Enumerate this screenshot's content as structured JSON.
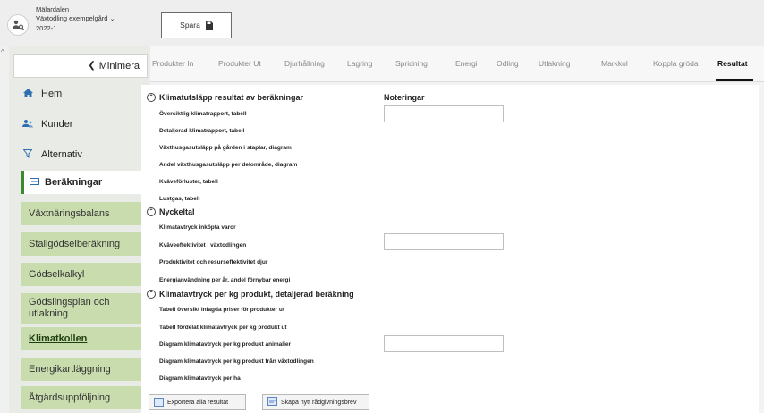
{
  "org": {
    "name": "Mälardalen",
    "farm": "Växtodling exempelgård",
    "year": "2022-1",
    "chevron": "⌄"
  },
  "toolbar": {
    "save_label": "Spara"
  },
  "sidebar": {
    "minimize_label": "Minimera",
    "items": [
      {
        "label": "Hem",
        "icon": "home-icon"
      },
      {
        "label": "Kunder",
        "icon": "users-icon"
      },
      {
        "label": "Alternativ",
        "icon": "filter-icon"
      },
      {
        "label": "Beräkningar",
        "icon": "calculator-icon"
      }
    ],
    "sub_items": [
      "Växtnäringsbalans",
      "Stallgödselberäkning",
      "Gödselkalkyl",
      "Gödslingsplan och utlakning",
      "Klimatkollen",
      "Energikartläggning",
      "Åtgärdsuppföljning"
    ]
  },
  "tabs": [
    "Produkter In",
    "Produkter Ut",
    "Djurhållning",
    "Lagring",
    "Spridning",
    "Energi",
    "Odling",
    "Utlakning",
    "Markkol",
    "Koppla gröda",
    "Resultat"
  ],
  "active_tab": "Resultat",
  "sections": [
    {
      "title": "Klimatutsläpp resultat av beräkningar",
      "items": [
        "Översiktlig klimatrapport, tabell",
        "Detaljerad klimatrapport, tabell",
        "Växthusgasutsläpp på gården i staplar, diagram",
        "Andel växthusgasutsläpp per delområde, diagram",
        "Kväveförluster, tabell",
        "Lustgas, tabell"
      ]
    },
    {
      "title": "Nyckeltal",
      "items": [
        "Klimatavtryck inköpta varor",
        "Kväveeffektivitet i växtodlingen",
        "Produktivitet och resurseffektivitet djur",
        "Energianvändning per år, andel förnybar energi"
      ]
    },
    {
      "title": "Klimatavtryck per kg produkt, detaljerad beräkning",
      "items": [
        "Tabell översikt inlagda priser för produkter ut",
        "Tabell fördelat klimatavtryck per kg produkt ut",
        "Diagram klimatavtryck per kg produkt animalier",
        "Diagram klimatavtryck per kg produkt från växtodlingen",
        "Diagram klimatavtryck per ha"
      ]
    }
  ],
  "notes": {
    "label": "Noteringar"
  },
  "actions": {
    "export_label": "Exportera alla resultat",
    "letter_label": "Skapa nytt rådgivningsbrev"
  },
  "colors": {
    "accent_green": "#3c8a2e",
    "sub_item_bg": "#c9dcad",
    "nav_icon_blue": "#2f6fb0"
  }
}
